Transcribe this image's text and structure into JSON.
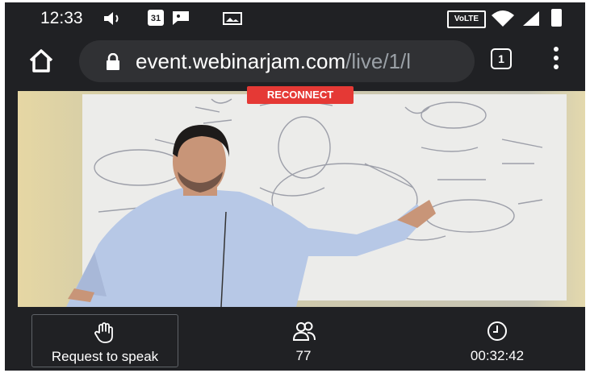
{
  "status_bar": {
    "time": "12:33",
    "calendar_day": "31",
    "network_badge": "VoLTE"
  },
  "browser": {
    "url_domain": "event.webinarjam.com",
    "url_path": "/live/1/l",
    "tab_count": "1"
  },
  "player": {
    "reconnect_label": "RECONNECT"
  },
  "controls": {
    "request_label": "Request to speak",
    "viewer_count": "77",
    "elapsed_time": "00:32:42"
  },
  "icons": {
    "volume": "volume-icon",
    "calendar": "calendar-icon",
    "chat": "chat-bubble-icon",
    "image": "image-icon",
    "wifi": "wifi-icon",
    "signal": "signal-icon",
    "battery": "battery-icon",
    "home": "home-icon",
    "lock": "lock-icon",
    "tabs": "tab-switcher-icon",
    "menu": "more-vert-icon",
    "hand": "raise-hand-icon",
    "people": "people-icon",
    "clock": "clock-icon"
  },
  "colors": {
    "background": "#202124",
    "address_pill": "#303134",
    "reconnect": "#e53935"
  }
}
